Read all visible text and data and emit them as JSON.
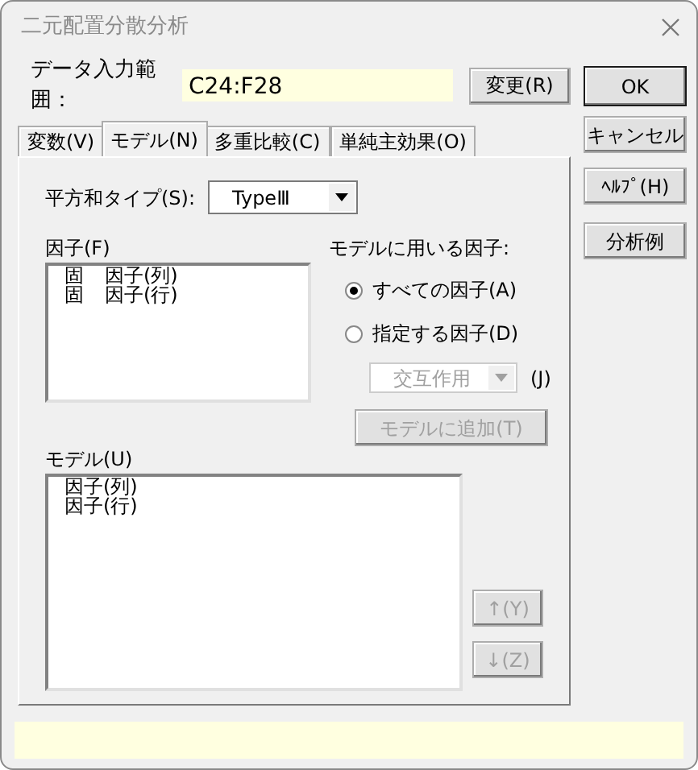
{
  "window": {
    "title": "二元配置分散分析"
  },
  "data_range": {
    "label": "データ入力範囲：",
    "value": "C24:F28",
    "button": "変更(R)"
  },
  "tabs": [
    {
      "label": "変数(V)",
      "selected": false
    },
    {
      "label": "モデル(N)",
      "selected": true
    },
    {
      "label": "多重比較(C)",
      "selected": false
    },
    {
      "label": "単純主効果(O)",
      "selected": false
    }
  ],
  "ss_type": {
    "label": "平方和タイプ(S):",
    "value": "TypeⅢ"
  },
  "factors": {
    "label": "因子(F)",
    "items": [
      {
        "tag": "固",
        "name": "因子(列)"
      },
      {
        "tag": "固",
        "name": "因子(行)"
      }
    ]
  },
  "model_factors": {
    "label": "モデルに用いる因子:",
    "options": [
      {
        "label": "すべての因子(A)",
        "selected": true
      },
      {
        "label": "指定する因子(D)",
        "selected": false
      }
    ]
  },
  "interaction": {
    "value": "交互作用",
    "disabled": true,
    "mnemonic": "(J)"
  },
  "add_button": {
    "label": "モデルに追加(T)",
    "disabled": true
  },
  "model": {
    "label": "モデル(U)",
    "items": [
      "因子(列)",
      "因子(行)"
    ]
  },
  "move_buttons": [
    {
      "label": "↑(Y)",
      "disabled": true
    },
    {
      "label": "↓(Z)",
      "disabled": true
    }
  ],
  "side_buttons": [
    {
      "label": "OK",
      "default": true
    },
    {
      "label": "キャンセル",
      "default": false
    },
    {
      "label": "ﾍﾙﾌﾟ(H)",
      "default": false
    },
    {
      "label": "分析例",
      "default": false
    }
  ]
}
